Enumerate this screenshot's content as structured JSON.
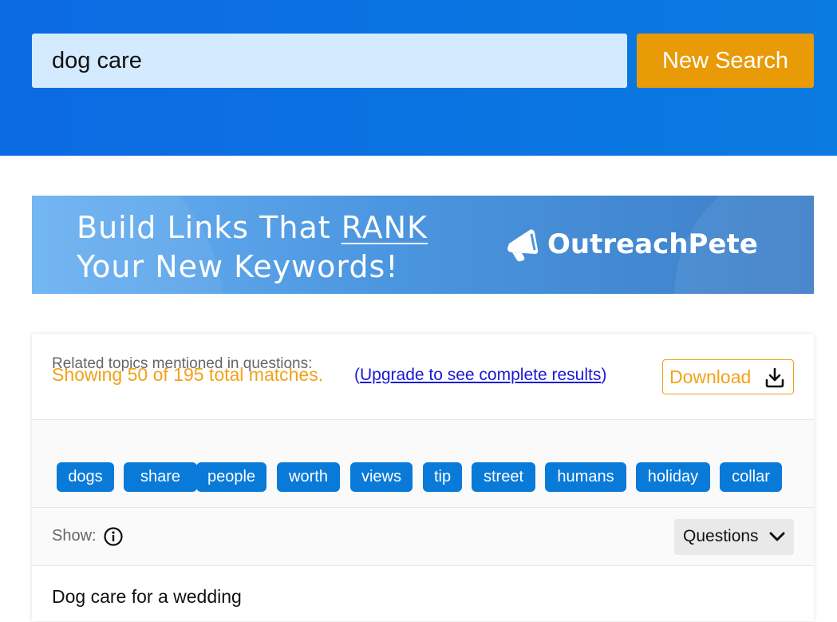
{
  "search": {
    "value": "dog care",
    "button_label": "New Search"
  },
  "banner": {
    "line1_prefix": "Build Links That ",
    "line1_emphasis": "RANK",
    "line2": "Your New Keywords!",
    "logo_text": "OutreachPete",
    "logo_icon": "megaphone-icon"
  },
  "results": {
    "match_text": "Showing 50 of 195 total matches.",
    "upgrade_open": "(",
    "upgrade_link": "Upgrade to see complete results",
    "upgrade_close": ")",
    "download_label": "Download",
    "download_icon": "download-icon"
  },
  "related": {
    "label": "Related topics mentioned in questions:",
    "topics": [
      "dogs",
      "share",
      "people",
      "worth",
      "views",
      "tip",
      "street",
      "humans",
      "holiday",
      "collar"
    ]
  },
  "show": {
    "label": "Show:",
    "info_icon": "info-icon",
    "selected": "Questions"
  },
  "questions": [
    "Dog care for a wedding"
  ],
  "colors": {
    "header_blue": "#0c6ae3",
    "search_bg": "#d4eafe",
    "button_orange": "#e99a07",
    "match_orange": "#f2a21a",
    "chip_blue": "#0a7ad9",
    "link_blue": "#1a1ad0"
  }
}
